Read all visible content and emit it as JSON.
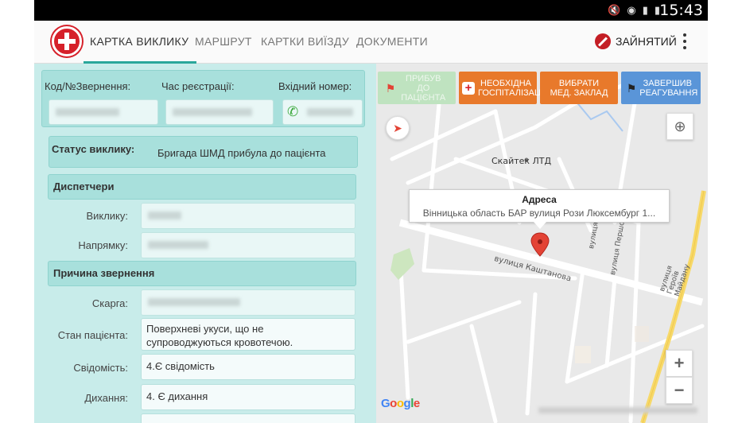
{
  "status_bar": {
    "time": "15:43",
    "icons": [
      "mute-icon",
      "wifi-icon",
      "signal-icon",
      "battery-icon"
    ]
  },
  "app_bar": {
    "tabs": [
      {
        "label": "КАРТКА ВИКЛИКУ",
        "active": true
      },
      {
        "label": "МАРШРУТ",
        "active": false
      },
      {
        "label": "КАРТКИ ВИЇЗДУ",
        "active": false
      },
      {
        "label": "ДОКУМЕНТИ",
        "active": false
      }
    ],
    "status_label": "ЗАЙНЯТИЙ"
  },
  "call": {
    "code_label": "Код/№Звернення:",
    "time_label": "Час реєстрації:",
    "incoming_label": "Вхідний номер:",
    "status_label": "Статус виклику:",
    "status_value": "Бригада ШМД прибула до пацієнта"
  },
  "dispatchers": {
    "title": "Диспетчери",
    "call_label": "Виклику:",
    "direction_label": "Напрямку:"
  },
  "reason": {
    "title": "Причина звернення",
    "complaint_label": "Скарга:",
    "patient_state_label": "Стан пацієнта:",
    "patient_state_value": "Поверхневі укуси, що не супроводжуються кровотечою.",
    "consciousness_label": "Свідомість:",
    "consciousness_value": "4.Є свідомість",
    "breathing_label": "Дихання:",
    "breathing_value": "4. Є дихання"
  },
  "actions": {
    "arrived": "ПРИБУВ ДО ПАЦІЄНТА",
    "hospitalization": "НЕОБХІДНА ГОСПІТАЛІЗАЦІЯ",
    "choose_facility": "ВИБРАТИ МЕД. ЗАКЛАД",
    "finish": "ЗАВЕРШИВ РЕАГУВАННЯ"
  },
  "map": {
    "popup_title": "Адреса",
    "popup_address": "Вінницька область БАР вулиця Рози Люксембург 1...",
    "poi_label": "Скайтек ЛТД",
    "street_kashtanova": "вулиця Каштанова",
    "street_heroes": "вулиця Героїв Майдану",
    "street_pershotravneva": "вулиця Першотравн",
    "street_small": "вулиця",
    "zoom_in": "+",
    "zoom_out": "−",
    "google": "Google"
  },
  "colors": {
    "accent": "#2aa79b",
    "panel_bg": "#c8ecea",
    "card_bg": "#a8e0dc",
    "btn_arrived": "#bfe3c0",
    "btn_orange": "#e8792b",
    "btn_blue": "#5a95d8",
    "busy_red": "#c41e25"
  }
}
